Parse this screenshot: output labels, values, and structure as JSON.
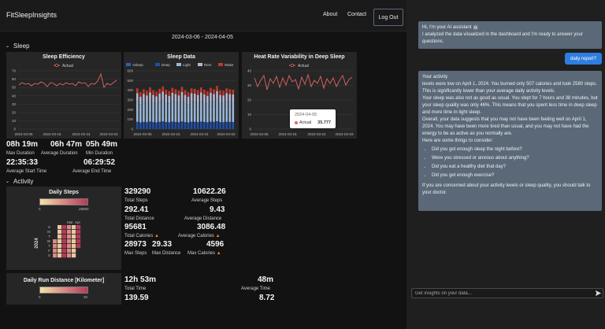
{
  "nav": {
    "brand": "FitSleepInsights",
    "about": "About",
    "contact": "Contact",
    "logout": "Log Out"
  },
  "date_range": "2024-03-06 - 2024-04-05",
  "sections": {
    "sleep": "Sleep",
    "activity": "Activity"
  },
  "icons": {
    "section_toggle": "chevron-down-icon",
    "calories": "flame-icon",
    "send": "send-icon",
    "assistant": "robot-icon"
  },
  "colors": {
    "accent": "#2f7de1",
    "line": "#e06666",
    "deep": "#1f4fa8",
    "light": "#9ab6d6",
    "rem": "#b6b7d3",
    "wake": "#c0392b"
  },
  "sleep_efficiency": {
    "title": "Sleep Efficiency",
    "legend": "Actual",
    "yticks": [
      "70",
      "60",
      "50",
      "40",
      "30",
      "20",
      "10",
      "0"
    ],
    "xticks": [
      "2024-03-06",
      "2024-03-15",
      "2024-03-24",
      "2024-04-03"
    ]
  },
  "sleep_data": {
    "title": "Sleep Data",
    "legend": [
      "Asleep",
      "Deep",
      "Light",
      "Rem",
      "Wake"
    ],
    "yticks": [
      "600",
      "500",
      "400",
      "300",
      "200",
      "100",
      "0"
    ],
    "xticks": [
      "2024-03-06",
      "2024-03-15",
      "2024-03-24",
      "2024-04-03"
    ]
  },
  "hrv": {
    "title": "Heat Rate Variability in Deep Sleep",
    "legend": "Actual",
    "yticks": [
      "40",
      "30",
      "20",
      "10",
      "0"
    ],
    "xticks": [
      "2024-03-06",
      "2024-03-15",
      "2024-03-24",
      "2024-04-03"
    ],
    "tooltip": {
      "date": "2024-04-05",
      "label": "Actual",
      "value": "35.777"
    }
  },
  "sleep_stats": {
    "max_duration": "08h 19m",
    "max_duration_label": "Max Duration",
    "avg_duration": "06h 47m",
    "avg_duration_label": "Average Duration",
    "min_duration": "05h 49m",
    "min_duration_label": "Min Duration",
    "avg_start": "22:35:33",
    "avg_start_label": "Average Start Time",
    "avg_end": "06:29:52",
    "avg_end_label": "Average End Time"
  },
  "daily_steps": {
    "title": "Daily Steps",
    "scale_min": "0",
    "scale_max": "28880",
    "months": [
      "Mar",
      "Apr"
    ],
    "days": [
      "S",
      "M",
      "T",
      "W",
      "T",
      "F",
      "S"
    ],
    "year": "2024"
  },
  "activity_stats": {
    "total_steps": "329290",
    "total_steps_label": "Total Steps",
    "avg_steps": "10622.26",
    "avg_steps_label": "Average Steps",
    "total_distance": "292.41",
    "total_distance_label": "Total Distance",
    "avg_distance": "9.43",
    "avg_distance_label": "Average Distance",
    "total_calories": "95681",
    "total_calories_label": "Total Calories",
    "avg_calories": "3086.48",
    "avg_calories_label": "Average Calories",
    "max_steps": "28973",
    "max_steps_label": "Max Steps",
    "max_distance": "29.33",
    "max_distance_label": "Max Distance",
    "max_calories": "4596",
    "max_calories_label": "Max Calories"
  },
  "run_distance": {
    "title": "Daily Run Distance [Kilometer]",
    "scale_min": "0",
    "scale_max": "30"
  },
  "run_stats": {
    "total_time": "12h 53m",
    "total_time_label": "Total Time",
    "avg_time": "48m",
    "avg_time_label": "Average Time",
    "total_km": "139.59",
    "avg_km": "8.72"
  },
  "chat": {
    "greeting_1": "Hi, I'm your AI assistant 🤖",
    "greeting_2": "I analyzed the data visualized in the dashboard and I'm ready to answer your questions.",
    "user_msg": "daily report?",
    "r_heading": "Your activity",
    "r_p1": "levels were low on April 1, 2024. You burned only 507 calories and took 2580 steps. This is significantly lower than your average daily activity levels.",
    "r_p2": "Your sleep was also not as good as usual. You slept for 7 hours and 38 minutes, but your sleep quality was only 46%. This means that you spent less time in deep sleep and more time in light sleep.",
    "r_p3": "Overall, your data suggests that you may not have been feeling well on April 1, 2024. You may have been more tired than usual, and you may not have had the energy to be as active as you normally are.",
    "r_p4": "Here are some things to consider:",
    "r_list": [
      "Did you get enough sleep the night before?",
      "Were you stressed or anxious about anything?",
      "Did you eat a healthy diet that day?",
      "Did you get enough exercise?"
    ],
    "r_p5": "If you are concerned about your activity levels or sleep quality, you should talk to your doctor.",
    "input_placeholder": "Get insights on your data..."
  }
}
